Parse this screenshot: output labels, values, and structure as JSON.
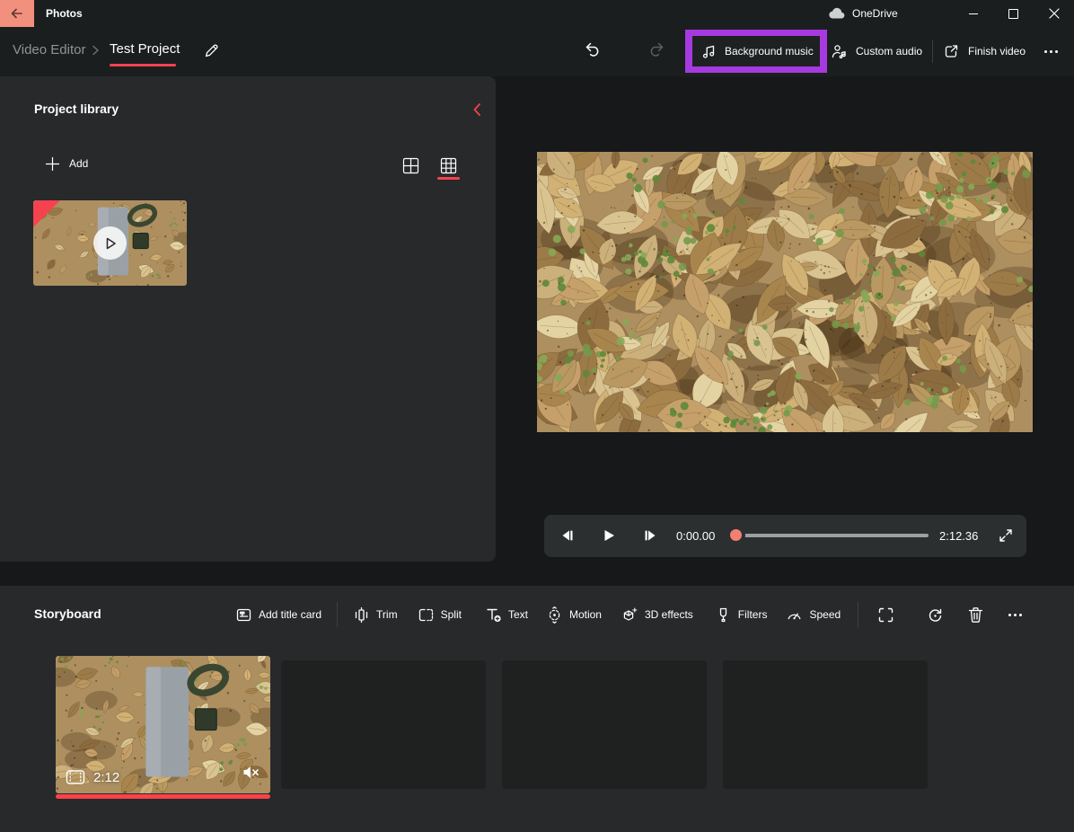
{
  "titlebar": {
    "app_title": "Photos",
    "onedrive_label": "OneDrive"
  },
  "toolbar": {
    "breadcrumb_root": "Video Editor",
    "breadcrumb_current": "Test Project",
    "background_music_label": "Background music",
    "custom_audio_label": "Custom audio",
    "finish_video_label": "Finish video"
  },
  "library": {
    "title": "Project library",
    "add_label": "Add"
  },
  "player": {
    "current_time": "0:00.00",
    "total_time": "2:12.36"
  },
  "storyboard": {
    "title": "Storyboard",
    "tools": [
      "Add title card",
      "Trim",
      "Split",
      "Text",
      "Motion",
      "3D effects",
      "Filters",
      "Speed"
    ],
    "clip_duration": "2:12"
  },
  "icons": {
    "back": "left-arrow",
    "onedrive": "cloud",
    "window": [
      "minimize",
      "maximize",
      "close"
    ],
    "undo": "arrow-undo",
    "redo": "arrow-undo-mirrored",
    "background_music": "music-note",
    "custom_audio": "person-music-note",
    "finish_video": "share-export",
    "more": "ellipsis",
    "library_collapse": "chevron-left",
    "view_toggles": [
      "grid-2x2",
      "grid-3x3"
    ],
    "clip_badges": [
      "film-strip",
      "speaker-muted"
    ],
    "player": [
      "previous-frame",
      "play",
      "next-frame",
      "fullscreen-expand"
    ],
    "storyboard_right": [
      "aspect-fit",
      "rotate",
      "delete-trash",
      "ellipsis"
    ]
  },
  "colors": {
    "accent_red": "#f5424e",
    "back_button_salmon": "#f2907e",
    "highlight_purple": "#a63ae0",
    "slider_thumb": "#f37f72",
    "panel_bg": "#27292a",
    "page_bg": "#161819"
  }
}
